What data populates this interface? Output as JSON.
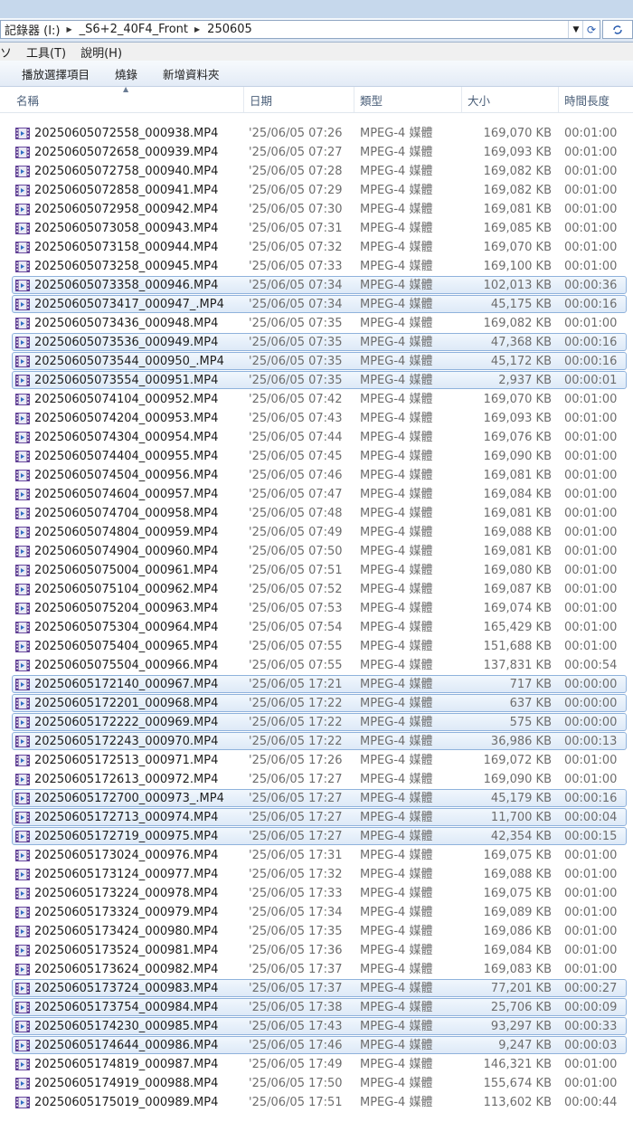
{
  "address": {
    "crumbs": [
      "記錄器 (I:)",
      "_S6+2_40F4_Front",
      "250605"
    ]
  },
  "menu": {
    "items": [
      "ソ",
      "工具(T)",
      "說明(H)"
    ]
  },
  "toolbar": {
    "buttons": [
      "播放選擇項目",
      "燒錄",
      "新增資料夾"
    ]
  },
  "columns": {
    "name": "名稱",
    "date": "日期",
    "type": "類型",
    "size": "大小",
    "length": "時間長度"
  },
  "files": [
    {
      "name": "20250605072558_000938.MP4",
      "date": "'25/06/05 07:26",
      "type": "MPEG-4 媒體",
      "size": "169,070 KB",
      "length": "00:01:00",
      "selected": false
    },
    {
      "name": "20250605072658_000939.MP4",
      "date": "'25/06/05 07:27",
      "type": "MPEG-4 媒體",
      "size": "169,093 KB",
      "length": "00:01:00",
      "selected": false
    },
    {
      "name": "20250605072758_000940.MP4",
      "date": "'25/06/05 07:28",
      "type": "MPEG-4 媒體",
      "size": "169,082 KB",
      "length": "00:01:00",
      "selected": false
    },
    {
      "name": "20250605072858_000941.MP4",
      "date": "'25/06/05 07:29",
      "type": "MPEG-4 媒體",
      "size": "169,082 KB",
      "length": "00:01:00",
      "selected": false
    },
    {
      "name": "20250605072958_000942.MP4",
      "date": "'25/06/05 07:30",
      "type": "MPEG-4 媒體",
      "size": "169,081 KB",
      "length": "00:01:00",
      "selected": false
    },
    {
      "name": "20250605073058_000943.MP4",
      "date": "'25/06/05 07:31",
      "type": "MPEG-4 媒體",
      "size": "169,085 KB",
      "length": "00:01:00",
      "selected": false
    },
    {
      "name": "20250605073158_000944.MP4",
      "date": "'25/06/05 07:32",
      "type": "MPEG-4 媒體",
      "size": "169,070 KB",
      "length": "00:01:00",
      "selected": false
    },
    {
      "name": "20250605073258_000945.MP4",
      "date": "'25/06/05 07:33",
      "type": "MPEG-4 媒體",
      "size": "169,100 KB",
      "length": "00:01:00",
      "selected": false
    },
    {
      "name": "20250605073358_000946.MP4",
      "date": "'25/06/05 07:34",
      "type": "MPEG-4 媒體",
      "size": "102,013 KB",
      "length": "00:00:36",
      "selected": true
    },
    {
      "name": "20250605073417_000947_.MP4",
      "date": "'25/06/05 07:34",
      "type": "MPEG-4 媒體",
      "size": "45,175 KB",
      "length": "00:00:16",
      "selected": true
    },
    {
      "name": "20250605073436_000948.MP4",
      "date": "'25/06/05 07:35",
      "type": "MPEG-4 媒體",
      "size": "169,082 KB",
      "length": "00:01:00",
      "selected": false
    },
    {
      "name": "20250605073536_000949.MP4",
      "date": "'25/06/05 07:35",
      "type": "MPEG-4 媒體",
      "size": "47,368 KB",
      "length": "00:00:16",
      "selected": true
    },
    {
      "name": "20250605073544_000950_.MP4",
      "date": "'25/06/05 07:35",
      "type": "MPEG-4 媒體",
      "size": "45,172 KB",
      "length": "00:00:16",
      "selected": true
    },
    {
      "name": "20250605073554_000951.MP4",
      "date": "'25/06/05 07:35",
      "type": "MPEG-4 媒體",
      "size": "2,937 KB",
      "length": "00:00:01",
      "selected": true
    },
    {
      "name": "20250605074104_000952.MP4",
      "date": "'25/06/05 07:42",
      "type": "MPEG-4 媒體",
      "size": "169,070 KB",
      "length": "00:01:00",
      "selected": false
    },
    {
      "name": "20250605074204_000953.MP4",
      "date": "'25/06/05 07:43",
      "type": "MPEG-4 媒體",
      "size": "169,093 KB",
      "length": "00:01:00",
      "selected": false
    },
    {
      "name": "20250605074304_000954.MP4",
      "date": "'25/06/05 07:44",
      "type": "MPEG-4 媒體",
      "size": "169,076 KB",
      "length": "00:01:00",
      "selected": false
    },
    {
      "name": "20250605074404_000955.MP4",
      "date": "'25/06/05 07:45",
      "type": "MPEG-4 媒體",
      "size": "169,090 KB",
      "length": "00:01:00",
      "selected": false
    },
    {
      "name": "20250605074504_000956.MP4",
      "date": "'25/06/05 07:46",
      "type": "MPEG-4 媒體",
      "size": "169,081 KB",
      "length": "00:01:00",
      "selected": false
    },
    {
      "name": "20250605074604_000957.MP4",
      "date": "'25/06/05 07:47",
      "type": "MPEG-4 媒體",
      "size": "169,084 KB",
      "length": "00:01:00",
      "selected": false
    },
    {
      "name": "20250605074704_000958.MP4",
      "date": "'25/06/05 07:48",
      "type": "MPEG-4 媒體",
      "size": "169,081 KB",
      "length": "00:01:00",
      "selected": false
    },
    {
      "name": "20250605074804_000959.MP4",
      "date": "'25/06/05 07:49",
      "type": "MPEG-4 媒體",
      "size": "169,088 KB",
      "length": "00:01:00",
      "selected": false
    },
    {
      "name": "20250605074904_000960.MP4",
      "date": "'25/06/05 07:50",
      "type": "MPEG-4 媒體",
      "size": "169,081 KB",
      "length": "00:01:00",
      "selected": false
    },
    {
      "name": "20250605075004_000961.MP4",
      "date": "'25/06/05 07:51",
      "type": "MPEG-4 媒體",
      "size": "169,080 KB",
      "length": "00:01:00",
      "selected": false
    },
    {
      "name": "20250605075104_000962.MP4",
      "date": "'25/06/05 07:52",
      "type": "MPEG-4 媒體",
      "size": "169,087 KB",
      "length": "00:01:00",
      "selected": false
    },
    {
      "name": "20250605075204_000963.MP4",
      "date": "'25/06/05 07:53",
      "type": "MPEG-4 媒體",
      "size": "169,074 KB",
      "length": "00:01:00",
      "selected": false
    },
    {
      "name": "20250605075304_000964.MP4",
      "date": "'25/06/05 07:54",
      "type": "MPEG-4 媒體",
      "size": "165,429 KB",
      "length": "00:01:00",
      "selected": false
    },
    {
      "name": "20250605075404_000965.MP4",
      "date": "'25/06/05 07:55",
      "type": "MPEG-4 媒體",
      "size": "151,688 KB",
      "length": "00:01:00",
      "selected": false
    },
    {
      "name": "20250605075504_000966.MP4",
      "date": "'25/06/05 07:55",
      "type": "MPEG-4 媒體",
      "size": "137,831 KB",
      "length": "00:00:54",
      "selected": false
    },
    {
      "name": "20250605172140_000967.MP4",
      "date": "'25/06/05 17:21",
      "type": "MPEG-4 媒體",
      "size": "717 KB",
      "length": "00:00:00",
      "selected": true
    },
    {
      "name": "20250605172201_000968.MP4",
      "date": "'25/06/05 17:22",
      "type": "MPEG-4 媒體",
      "size": "637 KB",
      "length": "00:00:00",
      "selected": true
    },
    {
      "name": "20250605172222_000969.MP4",
      "date": "'25/06/05 17:22",
      "type": "MPEG-4 媒體",
      "size": "575 KB",
      "length": "00:00:00",
      "selected": true
    },
    {
      "name": "20250605172243_000970.MP4",
      "date": "'25/06/05 17:22",
      "type": "MPEG-4 媒體",
      "size": "36,986 KB",
      "length": "00:00:13",
      "selected": true
    },
    {
      "name": "20250605172513_000971.MP4",
      "date": "'25/06/05 17:26",
      "type": "MPEG-4 媒體",
      "size": "169,072 KB",
      "length": "00:01:00",
      "selected": false
    },
    {
      "name": "20250605172613_000972.MP4",
      "date": "'25/06/05 17:27",
      "type": "MPEG-4 媒體",
      "size": "169,090 KB",
      "length": "00:01:00",
      "selected": false
    },
    {
      "name": "20250605172700_000973_.MP4",
      "date": "'25/06/05 17:27",
      "type": "MPEG-4 媒體",
      "size": "45,179 KB",
      "length": "00:00:16",
      "selected": true
    },
    {
      "name": "20250605172713_000974.MP4",
      "date": "'25/06/05 17:27",
      "type": "MPEG-4 媒體",
      "size": "11,700 KB",
      "length": "00:00:04",
      "selected": true
    },
    {
      "name": "20250605172719_000975.MP4",
      "date": "'25/06/05 17:27",
      "type": "MPEG-4 媒體",
      "size": "42,354 KB",
      "length": "00:00:15",
      "selected": true
    },
    {
      "name": "20250605173024_000976.MP4",
      "date": "'25/06/05 17:31",
      "type": "MPEG-4 媒體",
      "size": "169,075 KB",
      "length": "00:01:00",
      "selected": false
    },
    {
      "name": "20250605173124_000977.MP4",
      "date": "'25/06/05 17:32",
      "type": "MPEG-4 媒體",
      "size": "169,088 KB",
      "length": "00:01:00",
      "selected": false
    },
    {
      "name": "20250605173224_000978.MP4",
      "date": "'25/06/05 17:33",
      "type": "MPEG-4 媒體",
      "size": "169,075 KB",
      "length": "00:01:00",
      "selected": false
    },
    {
      "name": "20250605173324_000979.MP4",
      "date": "'25/06/05 17:34",
      "type": "MPEG-4 媒體",
      "size": "169,089 KB",
      "length": "00:01:00",
      "selected": false
    },
    {
      "name": "20250605173424_000980.MP4",
      "date": "'25/06/05 17:35",
      "type": "MPEG-4 媒體",
      "size": "169,086 KB",
      "length": "00:01:00",
      "selected": false
    },
    {
      "name": "20250605173524_000981.MP4",
      "date": "'25/06/05 17:36",
      "type": "MPEG-4 媒體",
      "size": "169,084 KB",
      "length": "00:01:00",
      "selected": false
    },
    {
      "name": "20250605173624_000982.MP4",
      "date": "'25/06/05 17:37",
      "type": "MPEG-4 媒體",
      "size": "169,083 KB",
      "length": "00:01:00",
      "selected": false
    },
    {
      "name": "20250605173724_000983.MP4",
      "date": "'25/06/05 17:37",
      "type": "MPEG-4 媒體",
      "size": "77,201 KB",
      "length": "00:00:27",
      "selected": true
    },
    {
      "name": "20250605173754_000984.MP4",
      "date": "'25/06/05 17:38",
      "type": "MPEG-4 媒體",
      "size": "25,706 KB",
      "length": "00:00:09",
      "selected": true
    },
    {
      "name": "20250605174230_000985.MP4",
      "date": "'25/06/05 17:43",
      "type": "MPEG-4 媒體",
      "size": "93,297 KB",
      "length": "00:00:33",
      "selected": true
    },
    {
      "name": "20250605174644_000986.MP4",
      "date": "'25/06/05 17:46",
      "type": "MPEG-4 媒體",
      "size": "9,247 KB",
      "length": "00:00:03",
      "selected": true
    },
    {
      "name": "20250605174819_000987.MP4",
      "date": "'25/06/05 17:49",
      "type": "MPEG-4 媒體",
      "size": "146,321 KB",
      "length": "00:01:00",
      "selected": false
    },
    {
      "name": "20250605174919_000988.MP4",
      "date": "'25/06/05 17:50",
      "type": "MPEG-4 媒體",
      "size": "155,674 KB",
      "length": "00:01:00",
      "selected": false
    },
    {
      "name": "20250605175019_000989.MP4",
      "date": "'25/06/05 17:51",
      "type": "MPEG-4 媒體",
      "size": "113,602 KB",
      "length": "00:00:44",
      "selected": false
    }
  ],
  "icons": {
    "file": "video-file-icon",
    "breadcrumb_separator": "chevron-right-icon",
    "dropdown": "chevron-down-icon",
    "refresh": "refresh-icon",
    "sort": "sort-up-icon"
  }
}
